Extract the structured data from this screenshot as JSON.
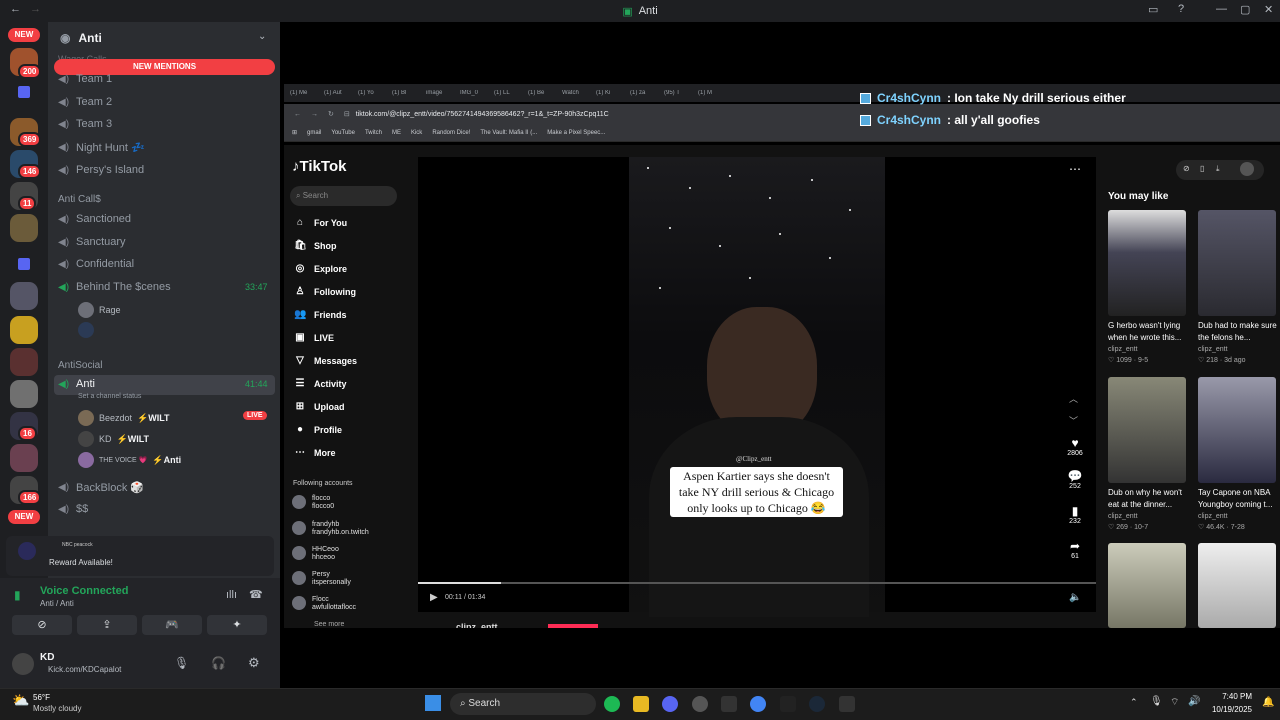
{
  "window": {
    "title": "Anti"
  },
  "rail": {
    "new_top": "NEW",
    "new_bottom": "NEW",
    "badges": [
      "200",
      "369",
      "146",
      "11",
      "16",
      "166"
    ]
  },
  "server": {
    "name": "Anti",
    "new_mentions": "NEW MENTIONS",
    "hidden_cat": "Wager Calls"
  },
  "channels_top": [
    "Team 1",
    "Team 2",
    "Team 3",
    "Night Hunt 💤",
    "Persy's Island"
  ],
  "cat_anticalls": "Anti Call$",
  "channels_mid": [
    "Sanctioned",
    "Sanctuary",
    "Confidential"
  ],
  "behind": {
    "name": "Behind The $cenes",
    "time": "33:47",
    "user": "Rage"
  },
  "cat_antisocial": "AntiSocial",
  "anti": {
    "name": "Anti",
    "time": "41:44",
    "status": "Set a channel status"
  },
  "voice_users": [
    {
      "name": "Beezdot",
      "tag": "⚡WILT",
      "live": "LIVE"
    },
    {
      "name": "KD",
      "tag": "⚡WILT"
    },
    {
      "name": "THE VOICE 💗",
      "tag": "⚡Anti"
    }
  ],
  "channels_bottom": [
    "BackBlock 🎲",
    "$$"
  ],
  "reward": {
    "brand": "NBC peacock",
    "text": "Reward Available!"
  },
  "voice": {
    "status": "Voice Connected",
    "location": "Anti / Anti"
  },
  "user": {
    "name": "KD",
    "status": "Kick.com/KDCapalot"
  },
  "chat_overlay": [
    {
      "user": "Cr4shCynn",
      "msg": ": Ion take Ny drill serious either"
    },
    {
      "user": "Cr4shCynn",
      "msg": ": all y'all goofies"
    }
  ],
  "browser": {
    "tabs": [
      "(1) Me",
      "(1) Aut",
      "(1) Yo",
      "(1) Bl",
      "image",
      "IMG_0",
      "(1) LL",
      "(1) Be",
      "Watch",
      "(1) Ki",
      "(1) za",
      "(95) T",
      "(1) M"
    ],
    "url": "tiktok.com/@clipz_entt/video/7562741494369586462?_r=1&_t=ZP-90h3zCpq11C",
    "bookmarks": [
      "gmail",
      "YouTube",
      "Twitch",
      "ME",
      "Kick",
      "Random Dice!",
      "The Vault: Mafia II (...",
      "Make a Pixel Speec..."
    ]
  },
  "tiktok": {
    "logo": "TikTok",
    "search_placeholder": "Search",
    "nav": [
      "For You",
      "Shop",
      "Explore",
      "Following",
      "Friends",
      "LIVE",
      "Messages",
      "Activity",
      "Upload",
      "Profile",
      "More"
    ],
    "following_header": "Following accounts",
    "following": [
      {
        "name": "flocco",
        "handle": "flocco0"
      },
      {
        "name": "frandyhb",
        "handle": "frandyhb.on.twitch"
      },
      {
        "name": "HHCeoo",
        "handle": "hhceoo"
      },
      {
        "name": "Persy",
        "handle": "itspersonally"
      },
      {
        "name": "Flocc",
        "handle": "awfullottaflocc"
      }
    ],
    "see_more": "See more",
    "caption_watermark": "@Clipz_entt",
    "caption": "Aspen Kartier says she doesn't take NY drill serious & Chicago only looks up to Chicago 😂",
    "time": "00:11 / 01:34",
    "author": "clipz_entt",
    "likes": "2806",
    "comments": "252",
    "saves": "232",
    "shares": "61",
    "you_may_like": "You may like",
    "recs": [
      {
        "title": "G herbo wasn't lying when he wrote this...",
        "author": "clipz_entt",
        "stats": "♡ 1099 · 9-5"
      },
      {
        "title": "Dub had to make sure the felons he...",
        "author": "clipz_entt",
        "stats": "♡ 218 · 3d ago"
      },
      {
        "title": "Dub on why he won't eat at the dinner...",
        "author": "clipz_entt",
        "stats": "♡ 269 · 10-7"
      },
      {
        "title": "Tay Capone on NBA Youngboy coming t...",
        "author": "clipz_entt",
        "stats": "♡ 46.4K · 7-28"
      }
    ]
  },
  "taskbar": {
    "weather_temp": "56°F",
    "weather_desc": "Mostly cloudy",
    "search": "Search",
    "time": "7:40 PM",
    "date": "10/19/2025"
  },
  "colors": {
    "accent_red": "#f23f43",
    "green": "#23a55a",
    "discord_bg": "#2b2d31"
  }
}
